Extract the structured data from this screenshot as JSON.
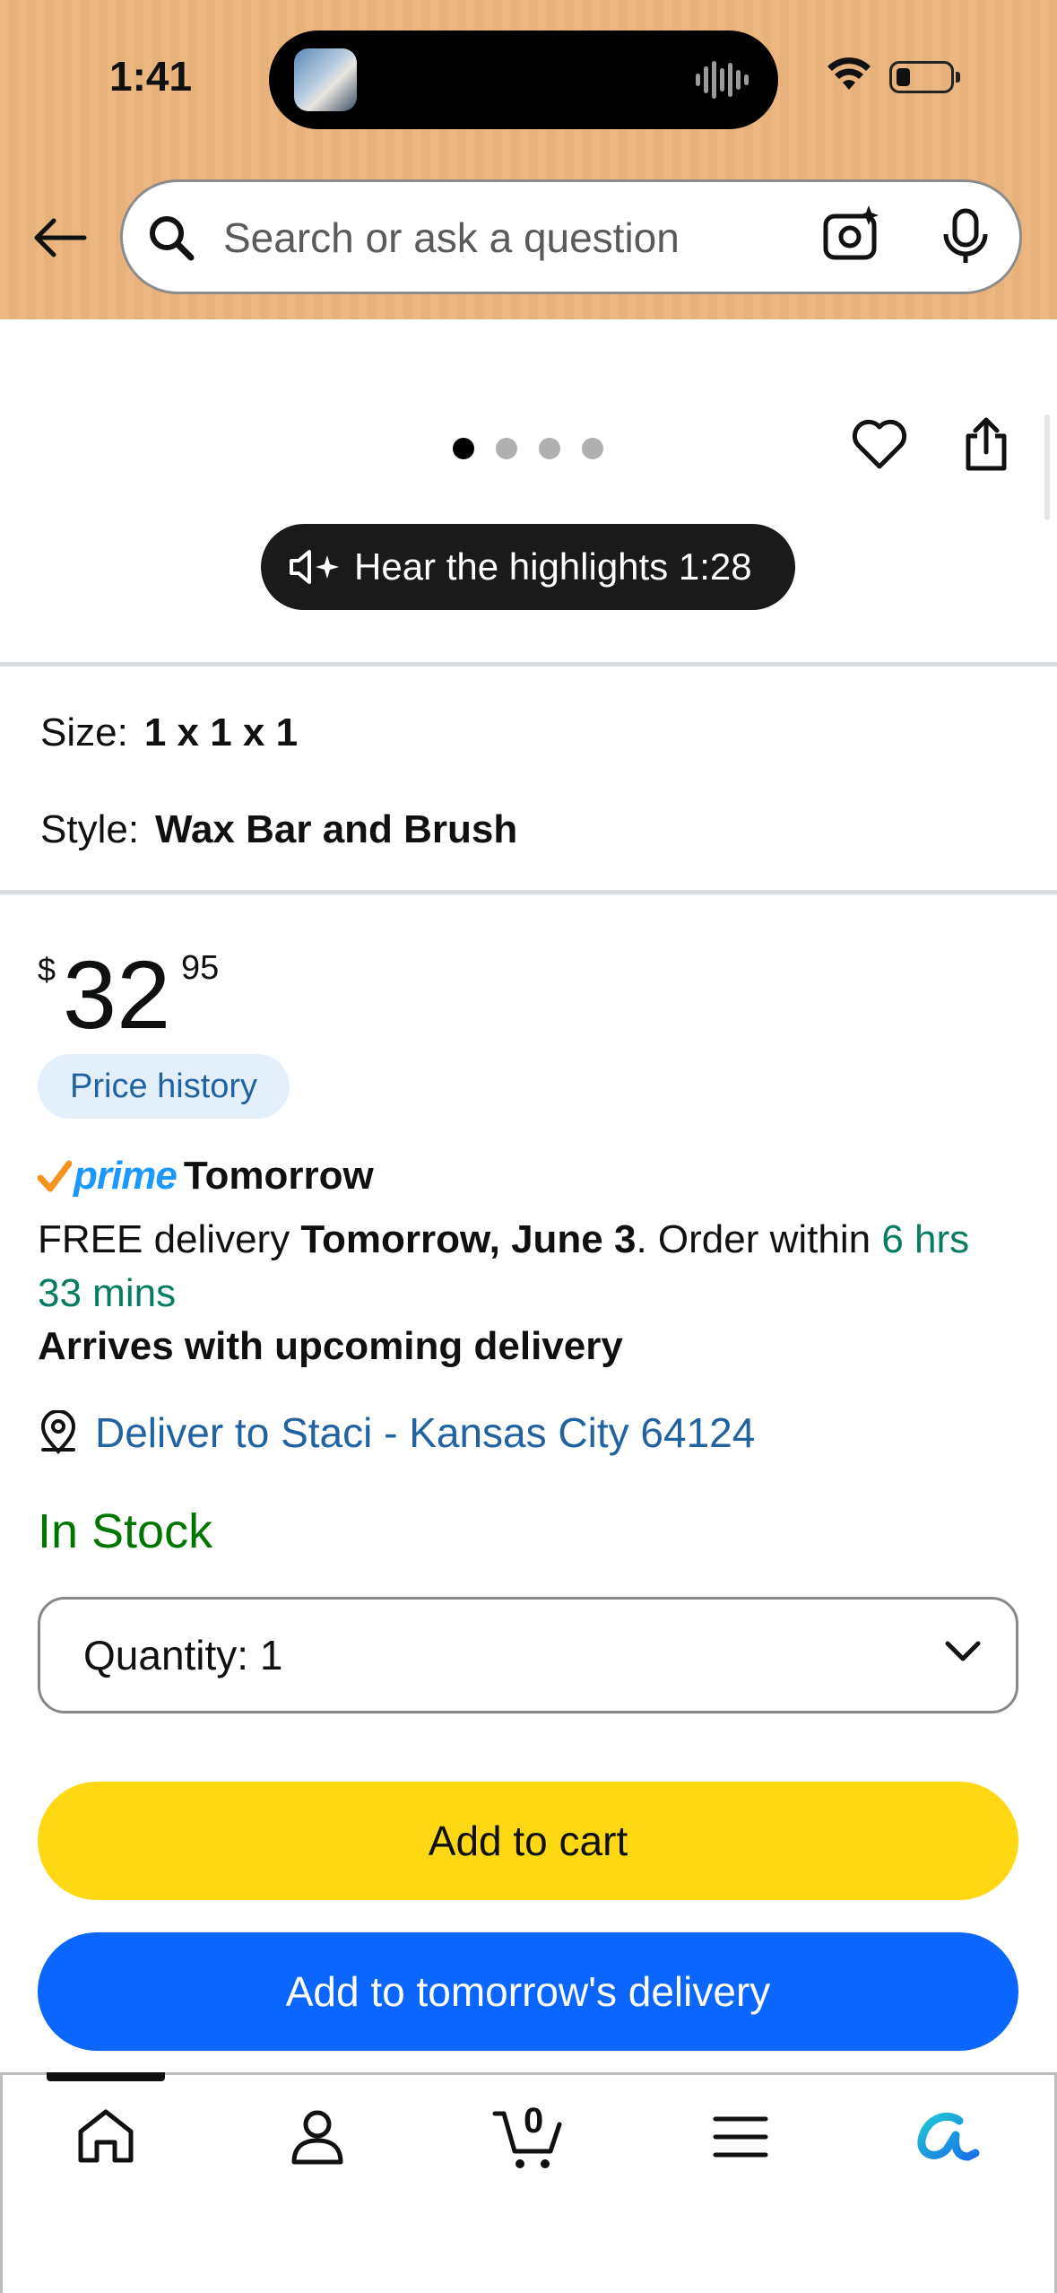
{
  "status_bar": {
    "time": "1:41"
  },
  "search": {
    "placeholder": "Search or ask a question"
  },
  "image_carousel": {
    "dot_count": 4,
    "active_index": 0
  },
  "hear_highlights": {
    "label": "Hear the highlights 1:28"
  },
  "variations": {
    "size": {
      "key": "Size:",
      "value": "1 x 1 x 1"
    },
    "style": {
      "key": "Style:",
      "value": "Wax Bar and Brush"
    }
  },
  "price": {
    "currency": "$",
    "whole": "32",
    "fraction": "95"
  },
  "price_history": {
    "label": "Price history"
  },
  "prime": {
    "word": "prime",
    "speed": "Tomorrow"
  },
  "delivery": {
    "prefix": "FREE delivery ",
    "date": "Tomorrow, June 3",
    "middle": ". Order within ",
    "countdown": "6 hrs 33 mins",
    "arrives": "Arrives with upcoming delivery"
  },
  "deliver_to": {
    "label": "Deliver to Staci - Kansas City 64124"
  },
  "stock": {
    "label": "In Stock"
  },
  "quantity": {
    "label": "Quantity:",
    "value": "1"
  },
  "buttons": {
    "add_to_cart": "Add to cart",
    "add_to_tomorrow": "Add to tomorrow's delivery"
  },
  "bottom_nav": {
    "items": [
      "home-icon",
      "account-icon",
      "cart-icon",
      "menu-icon",
      "rufus-icon"
    ],
    "cart_count": "0"
  },
  "colors": {
    "header_bg": "#ebb67f",
    "link_blue": "#2162a1",
    "stock_green": "#007600",
    "countdown_green": "#067d62",
    "cart_yellow": "#ffd814",
    "primary_blue": "#0a66ff",
    "prime_blue": "#1a98ff"
  }
}
